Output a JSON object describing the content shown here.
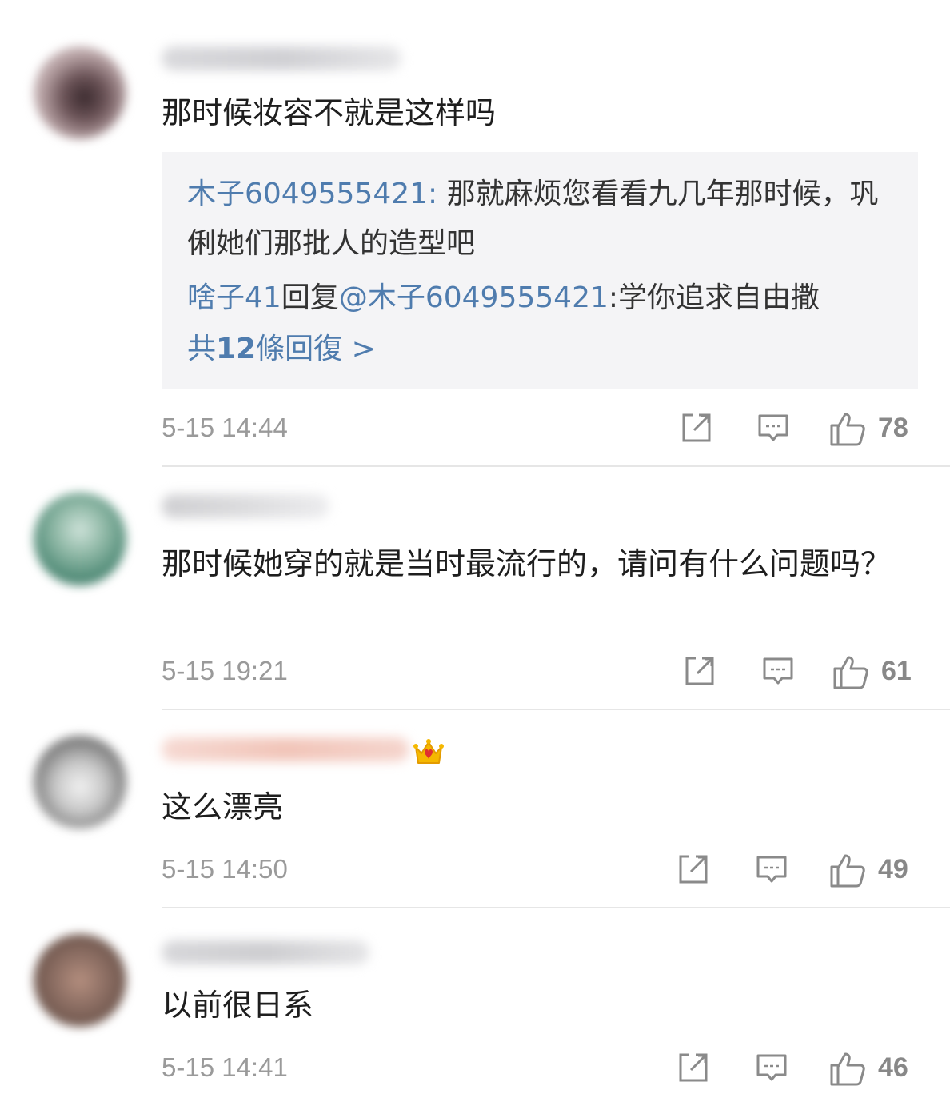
{
  "comments": [
    {
      "content": "那时候妆容不就是这样吗",
      "reply_preview": {
        "first_user": "木子6049555421",
        "first_text": "那就麻烦您看看九几年那时候，巩俐她们那批人的造型吧",
        "second_user": "啥子41",
        "second_connector": "回复",
        "second_mention": "@木子6049555421",
        "second_text": ":学你追求自由撒",
        "count_prefix": "共",
        "count_num": "12",
        "count_suffix": "條回復 >"
      },
      "timestamp": "5-15 14:44",
      "likes": "78"
    },
    {
      "content": "那时候她穿的就是当时最流行的，请问有什么问题吗？",
      "timestamp": "5-15 19:21",
      "likes": "61"
    },
    {
      "content": "这么漂亮",
      "timestamp": "5-15 14:50",
      "likes": "49"
    },
    {
      "content": "以前很日系",
      "timestamp": "5-15 14:41",
      "likes": "46"
    }
  ],
  "icons": {
    "share": "share-icon",
    "comment": "comment-icon",
    "like": "thumbs-up-icon",
    "crown": "crown-badge-icon"
  },
  "colors": {
    "link": "#4f7cae",
    "meta": "#9a9a9a",
    "reply_bg": "#f4f4f6"
  }
}
